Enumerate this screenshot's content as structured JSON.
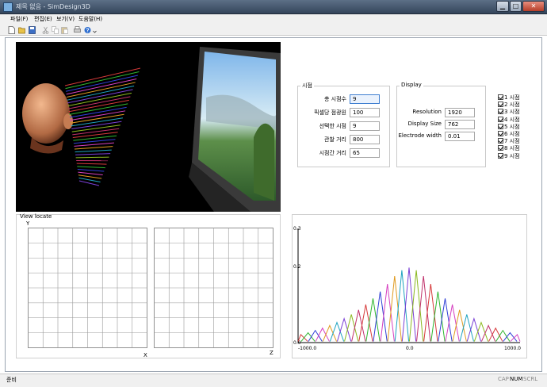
{
  "window": {
    "title": "제목 없음 - SimDesign3D",
    "controls": [
      "minimize-icon",
      "maximize-icon",
      "close-icon"
    ]
  },
  "menu": [
    "파일(F)",
    "편집(E)",
    "보기(V)",
    "도움말(H)"
  ],
  "toolbar": [
    "new-file-icon",
    "open-folder-icon",
    "save-icon",
    "cut-icon",
    "copy-icon",
    "paste-icon",
    "print-icon",
    "help-icon"
  ],
  "viewpoint_group": {
    "title": "시점",
    "fields": [
      {
        "label": "총 시점수",
        "value": "9"
      },
      {
        "label": "픽셀당 점광원",
        "value": "100"
      },
      {
        "label": "선택한 시점",
        "value": "9"
      },
      {
        "label": "관찰 거리",
        "value": "800"
      },
      {
        "label": "시점간 거리",
        "value": "65"
      }
    ]
  },
  "display_group": {
    "title": "Display",
    "fields": [
      {
        "label": "Resolution",
        "value": "1920"
      },
      {
        "label": "Display Size",
        "value": "762"
      },
      {
        "label": "Electrode width",
        "value": "0.01"
      }
    ]
  },
  "view_checks": [
    {
      "label": "1 시점",
      "checked": true
    },
    {
      "label": "2 시점",
      "checked": true
    },
    {
      "label": "3 시점",
      "checked": true
    },
    {
      "label": "4 시점",
      "checked": true
    },
    {
      "label": "5 시점",
      "checked": true
    },
    {
      "label": "6 시점",
      "checked": true
    },
    {
      "label": "7 시점",
      "checked": true
    },
    {
      "label": "8 시점",
      "checked": true
    },
    {
      "label": "9 시점",
      "checked": true
    }
  ],
  "view_locate": {
    "title": "View locate",
    "axis_y": "Y",
    "axis_x": "X",
    "axis_z": "Z"
  },
  "chart_data": {
    "type": "line",
    "xlim": [
      -1000,
      1000
    ],
    "ylim": [
      0,
      0.3
    ],
    "x_ticks": [
      "-1000.0",
      "0.0",
      "1000.0"
    ],
    "y_ticks": [
      "0.3",
      "0.2",
      "0.0"
    ],
    "series_colors": [
      "#d63a3a",
      "#2fb52f",
      "#2f3fd6",
      "#d640c0",
      "#e09a1e",
      "#1ea3c0",
      "#7a3fd6",
      "#8ab81e",
      "#c0306a"
    ],
    "peak_spacing": 65,
    "peak_width": 62,
    "peaks_x": [
      -975,
      -910,
      -845,
      -780,
      -715,
      -650,
      -585,
      -520,
      -455,
      -390,
      -325,
      -260,
      -195,
      -130,
      -65,
      0,
      65,
      130,
      195,
      260,
      325,
      390,
      455,
      520,
      585,
      650,
      715,
      780,
      845,
      910,
      975
    ],
    "peaks_y": [
      0.021,
      0.026,
      0.032,
      0.038,
      0.045,
      0.053,
      0.063,
      0.074,
      0.086,
      0.1,
      0.116,
      0.134,
      0.154,
      0.175,
      0.19,
      0.197,
      0.19,
      0.175,
      0.154,
      0.134,
      0.116,
      0.1,
      0.086,
      0.074,
      0.063,
      0.053,
      0.045,
      0.038,
      0.032,
      0.026,
      0.021
    ]
  },
  "status": {
    "left": "준비",
    "cap": "CAP",
    "num": "NUM",
    "scrl": "SCRL"
  }
}
